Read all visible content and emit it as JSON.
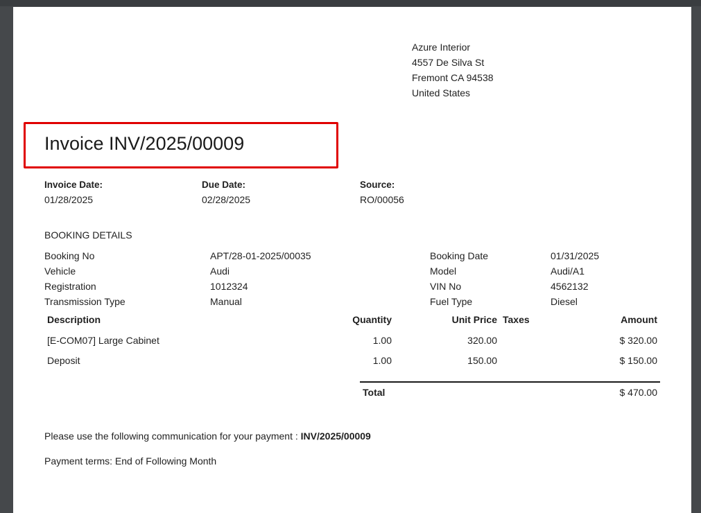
{
  "address": {
    "name": "Azure Interior",
    "street": "4557 De Silva St",
    "city_line": "Fremont CA 94538",
    "country": "United States"
  },
  "invoice": {
    "title": "Invoice INV/2025/00009",
    "date_label": "Invoice Date:",
    "date": "01/28/2025",
    "due_label": "Due Date:",
    "due": "02/28/2025",
    "source_label": "Source:",
    "source": "RO/00056"
  },
  "booking": {
    "heading": "BOOKING DETAILS",
    "booking_no_label": "Booking No",
    "booking_no": "APT/28-01-2025/00035",
    "vehicle_label": "Vehicle",
    "vehicle": "Audi",
    "registration_label": "Registration",
    "registration": "1012324",
    "transmission_label": "Transmission Type",
    "transmission": "Manual",
    "booking_date_label": "Booking Date",
    "booking_date": "01/31/2025",
    "model_label": "Model",
    "model": "Audi/A1",
    "vin_label": "VIN No",
    "vin": "4562132",
    "fuel_label": "Fuel Type",
    "fuel": "Diesel"
  },
  "lines": {
    "headers": {
      "description": "Description",
      "quantity": "Quantity",
      "unit_price": "Unit Price",
      "taxes": "Taxes",
      "amount": "Amount"
    },
    "rows": [
      {
        "description": "[E-COM07] Large Cabinet",
        "quantity": "1.00",
        "unit_price": "320.00",
        "amount": "$ 320.00"
      },
      {
        "description": "Deposit",
        "quantity": "1.00",
        "unit_price": "150.00",
        "amount": "$ 150.00"
      }
    ],
    "total_label": "Total",
    "total": "$ 470.00"
  },
  "footer": {
    "communication_text": "Please use the following communication for your payment : ",
    "communication_ref": "INV/2025/00009",
    "payment_terms": "Payment terms: End of Following Month"
  }
}
